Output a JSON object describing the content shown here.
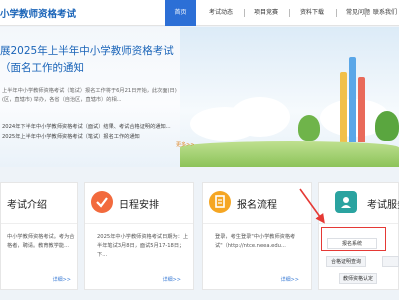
{
  "header": {
    "site_title": "小学教师资格考试",
    "nav": [
      {
        "label": "首页",
        "active": true
      },
      {
        "label": "考试动态",
        "active": false
      },
      {
        "label": "项目竞赛",
        "active": false
      },
      {
        "label": "资料下载",
        "active": false
      },
      {
        "label": "常见问题",
        "active": false
      },
      {
        "label": "联系我们",
        "active": false
      }
    ]
  },
  "hero": {
    "title": "展2025年上半年中小学教师资格考试（面名工作的通知",
    "summary": "上半年中小学教师资格考试（笔试）报名工作将于6月21日开始，此次面(日)(区，直辖市) 举办，各省（自治区，直辖市）的相...",
    "news": [
      "2024年下半年中小学教师资格考试（面试）结果、考试合格证明的通知...",
      "2025年上半年中小学教师资格考试（笔试）报名工作的通知"
    ],
    "more": "更多>>"
  },
  "cards": [
    {
      "title": "考试介绍",
      "body": "中小学教师资格考试。考为合格者，聘请。教育教学能...",
      "body_full": "全国中小学教师资格考试，考\n试合格者，由教育部和资格认\n聘请，教育教学能...",
      "more": "详细>>",
      "icon": "book-icon"
    },
    {
      "title": "日程安排",
      "body": "2025年中小学教师资格考试日期为：上半年笔试3月8日，面试5月17-18日；下...",
      "more": "详细>>",
      "icon": "checkmark-icon"
    },
    {
      "title": "报名流程",
      "body": "登录，考生登录\"中小学教师资格考试\"（http://ntce.neea.edu...",
      "more": "详细>>",
      "icon": "document-icon"
    },
    {
      "title": "考试服务",
      "icon": "person-badge-icon"
    }
  ],
  "services": [
    "报名系统",
    "合格证明查询",
    "教师资格认定"
  ],
  "colors": {
    "brand": "#1a64b8",
    "nav_active": "#2c6fd6",
    "highlight": "#e53935",
    "more": "#e08a2d"
  }
}
